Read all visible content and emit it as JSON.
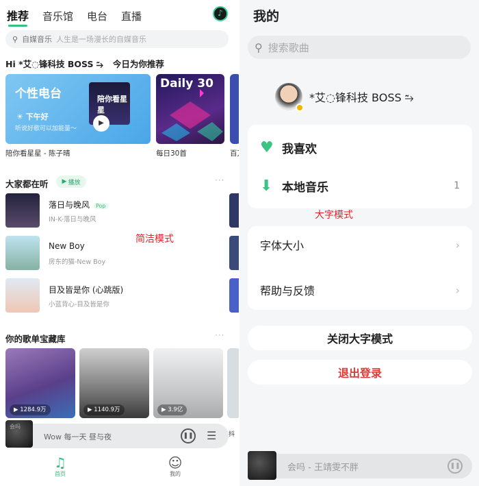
{
  "left": {
    "tabs": [
      "推荐",
      "音乐馆",
      "电台",
      "直播"
    ],
    "search": {
      "hint": "自媒音乐",
      "placeholder": "人生是一场漫长的自媒音乐"
    },
    "greeting": {
      "hi": "Hi *艾◌锋科技 BOSS ⥲",
      "text": "今日为你推荐"
    },
    "cards": [
      {
        "title": "个性电台",
        "sub1": "下午好",
        "sub2": "听说好歌可以加能量～",
        "album": "陪你看星星",
        "caption": "陪你看星星 - 陈子晴"
      },
      {
        "title": "Daily 30",
        "caption": "每日30首"
      },
      {
        "caption": "百万"
      }
    ],
    "listening": {
      "title": "大家都在听",
      "play": "播放"
    },
    "songs": [
      {
        "title": "落日与晚风",
        "tag": "Pop",
        "sub": "IN-K-落日与晚风",
        "cover_colors": [
          "#23233d",
          "#5a4b6b"
        ]
      },
      {
        "title": "New Boy",
        "tag": "",
        "sub": "房东的猫-New Boy",
        "cover_colors": [
          "#bfe3f0",
          "#86b2a3"
        ]
      },
      {
        "title": "目及皆是你 (心跳版)",
        "tag": "",
        "sub": "小蓝背心-目及皆是你",
        "cover_colors": [
          "#dfe9f3",
          "#f0c6b4"
        ]
      }
    ],
    "annotation": "简洁模式",
    "treasury": {
      "title": "你的歌单宝藏库"
    },
    "playlists": [
      {
        "count": "1284.9万"
      },
      {
        "count": "1140.9万"
      },
      {
        "count": "3.9亿"
      },
      {
        "count": "抖"
      }
    ],
    "player": {
      "cover_text": "会吗",
      "text": "Wow 每一天 昼与夜"
    },
    "nav": [
      {
        "label": "首页"
      },
      {
        "label": "我的"
      }
    ]
  },
  "right": {
    "title": "我的",
    "search_placeholder": "搜索歌曲",
    "username": "*艾◌锋科技 BOSS ⥲",
    "favorites": "我喜欢",
    "local_music": "本地音乐",
    "local_count": "1",
    "annotation": "大字模式",
    "font_size": "字体大小",
    "help": "帮助与反馈",
    "close_big": "关闭大字模式",
    "logout": "退出登录",
    "player_text": "会吗 - 王靖雯不胖"
  },
  "colors": {
    "accent": "#32c27d",
    "annotation": "#e0232e",
    "logout": "#e53935"
  }
}
